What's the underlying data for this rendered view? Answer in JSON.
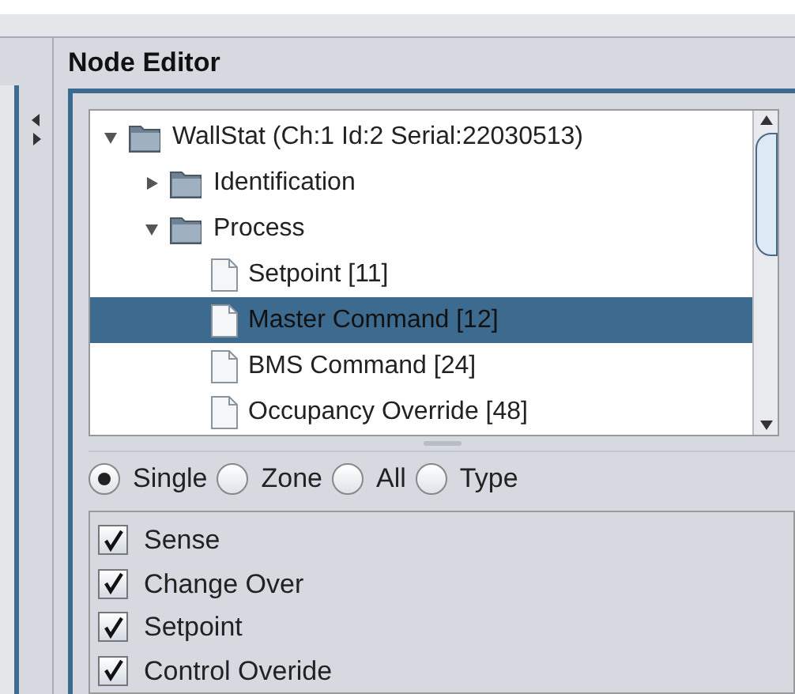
{
  "panel": {
    "title": "Node Editor"
  },
  "tree": [
    {
      "label": "WallStat (Ch:1 Id:2 Serial:22030513)",
      "kind": "folder",
      "expanded": true,
      "selected": false,
      "children": [
        {
          "label": "Identification",
          "kind": "folder",
          "expanded": false,
          "selected": false
        },
        {
          "label": "Process",
          "kind": "folder",
          "expanded": true,
          "selected": false,
          "children": [
            {
              "label": "Setpoint [11]",
              "kind": "leaf",
              "selected": false
            },
            {
              "label": "Master Command [12]",
              "kind": "leaf",
              "selected": true
            },
            {
              "label": "BMS Command [24]",
              "kind": "leaf",
              "selected": false
            },
            {
              "label": "Occupancy Override [48]",
              "kind": "leaf",
              "selected": false
            }
          ]
        }
      ]
    }
  ],
  "modes": [
    {
      "label": "Single",
      "selected": true
    },
    {
      "label": "Zone",
      "selected": false
    },
    {
      "label": "All",
      "selected": false
    },
    {
      "label": "Type",
      "selected": false
    }
  ],
  "options": [
    {
      "label": "Sense",
      "checked": true
    },
    {
      "label": "Change Over",
      "checked": true
    },
    {
      "label": "Setpoint",
      "checked": true
    },
    {
      "label": "Control Overide",
      "checked": true
    }
  ]
}
